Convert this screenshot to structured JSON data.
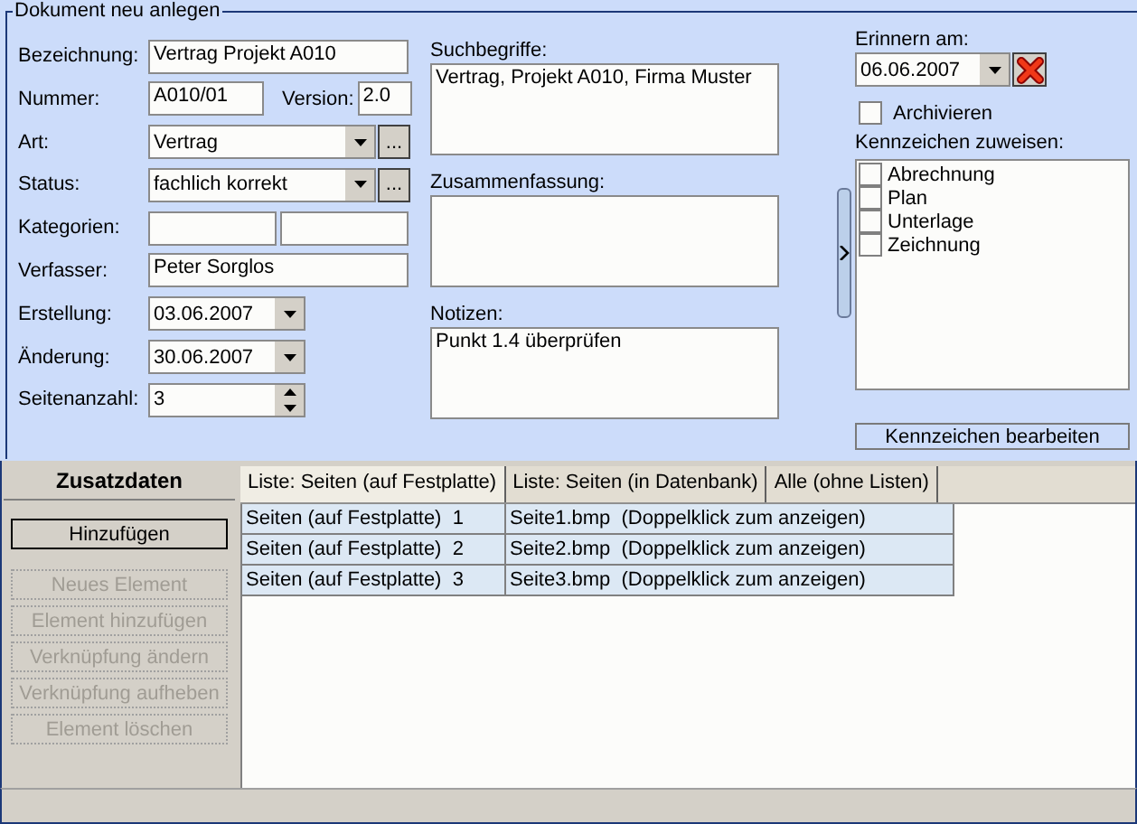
{
  "window": {
    "title": "Dokument neu anlegen"
  },
  "fields": [
    {
      "kind": "text",
      "label": "Bezeichnung:",
      "value": "Vertrag Projekt A010"
    },
    {
      "kind": "pair",
      "label": "Nummer:",
      "value": "A010/01",
      "label_2": "Version:",
      "value_2": "2.0"
    },
    {
      "kind": "combo_more",
      "label": "Art:",
      "value": "Vertrag",
      "more": "..."
    },
    {
      "kind": "combo_more",
      "label": "Status:",
      "value": "fachlich korrekt",
      "more": "..."
    },
    {
      "kind": "split",
      "label": "Kategorien:"
    },
    {
      "kind": "text",
      "label": "Verfasser:",
      "value": "Peter Sorglos"
    },
    {
      "kind": "date",
      "label": "Erstellung:",
      "value": "03.06.2007"
    },
    {
      "kind": "date",
      "label": "Änderung:",
      "value": "30.06.2007"
    },
    {
      "kind": "spin",
      "label": "Seitenanzahl:",
      "value": "3"
    }
  ],
  "text_areas": [
    {
      "label": "Suchbegriffe:",
      "value": "Vertrag, Projekt A010, Firma Muster"
    },
    {
      "label": "Zusammenfassung:"
    },
    {
      "label": "Notizen:",
      "value": "Punkt 1.4 überprüfen"
    }
  ],
  "reminder": {
    "label": "Erinnern am:",
    "value": "06.06.2007"
  },
  "archive": {
    "label": "Archivieren",
    "checked": false
  },
  "flags": {
    "label": "Kennzeichen zuweisen:",
    "items": [
      {
        "label": "Abrechnung",
        "checked": false
      },
      {
        "label": "Plan",
        "checked": false
      },
      {
        "label": "Unterlage",
        "checked": false
      },
      {
        "label": "Zeichnung",
        "checked": false
      }
    ],
    "button": "Kennzeichen bearbeiten"
  },
  "extra": {
    "title": "Zusatzdaten",
    "buttons": [
      {
        "label": "Hinzufügen",
        "disabled": false
      },
      {
        "label": "Neues Element",
        "disabled": true
      },
      {
        "label": "Element hinzufügen",
        "disabled": true
      },
      {
        "label": "Verknüpfung ändern",
        "disabled": true
      },
      {
        "label": "Verknüpfung aufheben",
        "disabled": true
      },
      {
        "label": "Element löschen",
        "disabled": true
      }
    ]
  },
  "tabs": [
    {
      "label": "Liste: Seiten (auf Festplatte)",
      "selected": true
    },
    {
      "label": "Liste: Seiten (in Datenbank)",
      "selected": false
    },
    {
      "label": "Alle (ohne Listen)",
      "selected": false
    }
  ],
  "table": {
    "rows": [
      [
        "Seiten (auf Festplatte)  1",
        "Seite1.bmp  (Doppelklick zum anzeigen)"
      ],
      [
        "Seiten (auf Festplatte)  2",
        "Seite2.bmp  (Doppelklick zum anzeigen)"
      ],
      [
        "Seiten (auf Festplatte)  3",
        "Seite3.bmp  (Doppelklick zum anzeigen)"
      ]
    ]
  }
}
